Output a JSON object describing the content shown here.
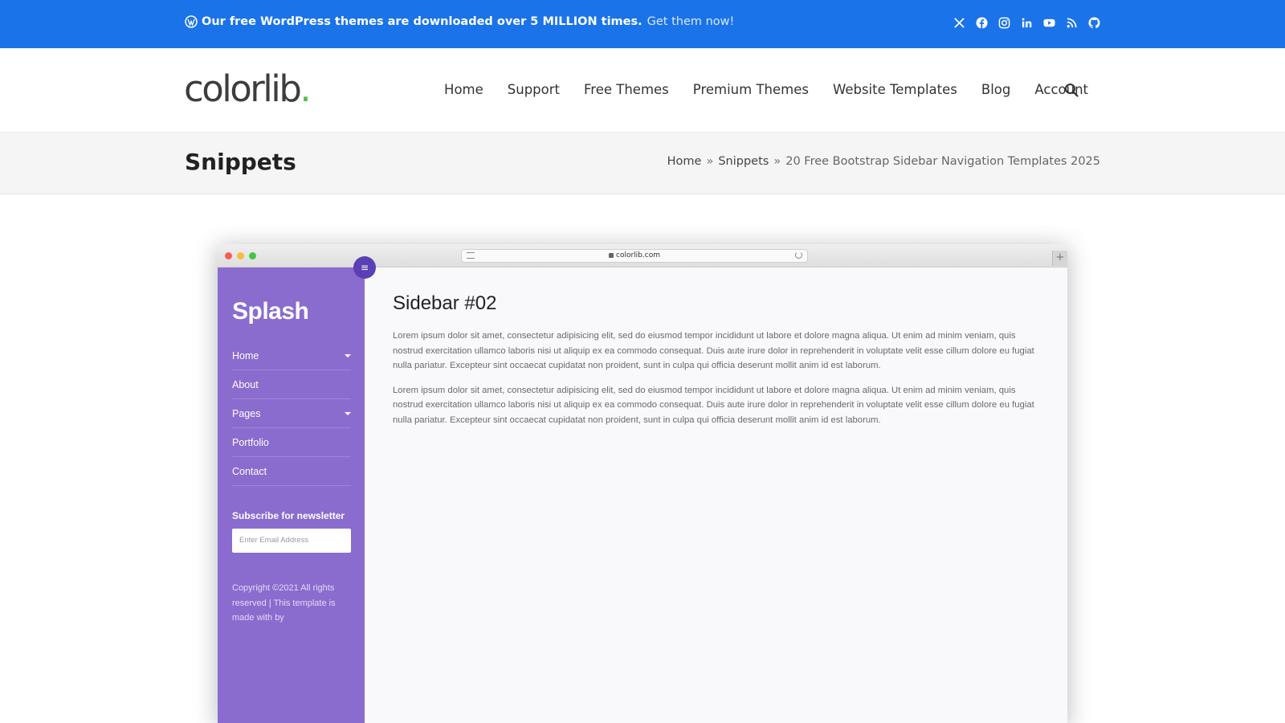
{
  "topbar": {
    "promo_bold": "Our free WordPress themes are downloaded over 5 MILLION times.",
    "promo_link": "Get them now!",
    "social_icons": [
      "x-icon",
      "facebook-icon",
      "instagram-icon",
      "linkedin-icon",
      "youtube-icon",
      "rss-icon",
      "github-icon"
    ]
  },
  "header": {
    "logo": "colorlib",
    "logo_dot": ".",
    "nav": [
      "Home",
      "Support",
      "Free Themes",
      "Premium Themes",
      "Website Templates",
      "Blog",
      "Account"
    ]
  },
  "titlebar": {
    "title": "Snippets",
    "breadcrumb": {
      "home": "Home",
      "sep": "»",
      "section": "Snippets",
      "current": "20 Free Bootstrap Sidebar Navigation Templates 2025"
    }
  },
  "mock": {
    "url": "colorlib.com",
    "sidebar": {
      "brand": "Splash",
      "menu": [
        "Home",
        "About",
        "Pages",
        "Portfolio",
        "Contact"
      ],
      "newsletter_title": "Subscribe for newsletter",
      "email_placeholder": "Enter Email Address",
      "copyright": "Copyright ©2021 All rights reserved | This template is made with by"
    },
    "content": {
      "heading": "Sidebar #02",
      "paragraphs": [
        "Lorem ipsum dolor sit amet, consectetur adipisicing elit, sed do eiusmod tempor incididunt ut labore et dolore magna aliqua. Ut enim ad minim veniam, quis nostrud exercitation ullamco laboris nisi ut aliquip ex ea commodo consequat. Duis aute irure dolor in reprehenderit in voluptate velit esse cillum dolore eu fugiat nulla pariatur. Excepteur sint occaecat cupidatat non proident, sunt in culpa qui officia deserunt mollit anim id est laborum.",
        "Lorem ipsum dolor sit amet, consectetur adipisicing elit, sed do eiusmod tempor incididunt ut labore et dolore magna aliqua. Ut enim ad minim veniam, quis nostrud exercitation ullamco laboris nisi ut aliquip ex ea commodo consequat. Duis aute irure dolor in reprehenderit in voluptate velit esse cillum dolore eu fugiat nulla pariatur. Excepteur sint occaecat cupidatat non proident, sunt in culpa qui officia deserunt mollit anim id est laborum."
      ]
    }
  },
  "colors": {
    "topbar_bg": "#1a73e8",
    "logo_dot": "#4cbf4b",
    "sidebar_bg": "#8a6ccf",
    "toggle_bg": "#5b3fb5"
  }
}
